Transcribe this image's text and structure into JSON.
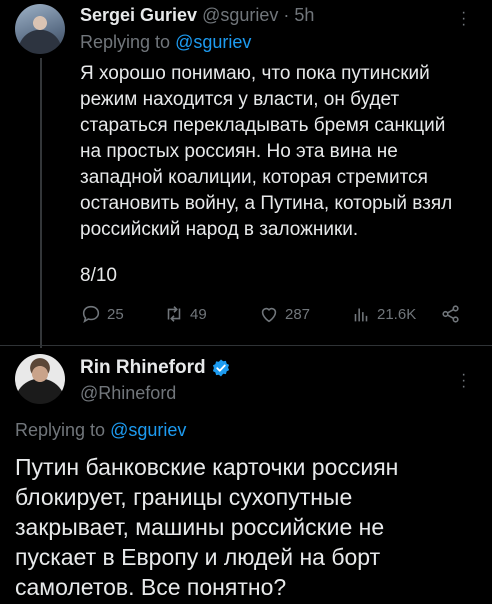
{
  "tweet1": {
    "author_name": "Sergei Guriev",
    "author_handle": "@sguriev",
    "separator": "·",
    "time": "5h",
    "replying_prefix": "Replying to ",
    "replying_handle": "@sguriev",
    "text": "Я хорошо понимаю, что пока путинский\nрежим находится у власти, он будет\nстараться перекладывать бремя санкций\nна простых россиян. Но эта вина не\nзападной коалиции, которая стремится\nостановить войну, а Путина, который взял\nроссийский народ в заложники.",
    "thread_counter": "8/10",
    "actions": {
      "replies": "25",
      "retweets": "49",
      "likes": "287",
      "views": "21.6K"
    }
  },
  "tweet2": {
    "author_name": "Rin Rhineford",
    "author_handle": "@Rhineford",
    "verified": true,
    "replying_prefix": "Replying to ",
    "replying_handle": "@sguriev",
    "text": "Путин банковские карточки россиян\nблокирует, границы сухопутные\nзакрывает, машины российские не\nпускает в Европу и людей на борт\nсамолетов. Все понятно?"
  },
  "colors": {
    "background": "#000000",
    "text": "#e7e9ea",
    "muted": "#71767b",
    "link": "#1d9bf0",
    "verified": "#1d9bf0",
    "divider": "#2f3336"
  },
  "icons": {
    "more": "more-dots-icon",
    "reply": "reply-icon",
    "retweet": "retweet-icon",
    "like": "heart-icon",
    "views": "views-bar-chart-icon",
    "share": "share-icon",
    "verified": "verified-badge-icon"
  }
}
